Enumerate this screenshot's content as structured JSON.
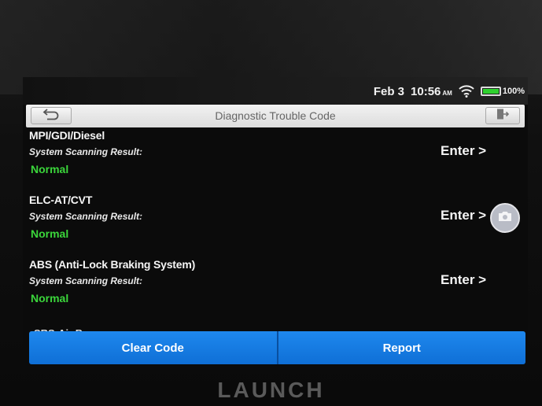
{
  "status_bar": {
    "date": "Feb 3",
    "time": "10:56",
    "ampm": "AM",
    "battery": "100%",
    "battery_level": 1.0,
    "icons": [
      "wifi-icon",
      "battery-icon"
    ]
  },
  "header": {
    "title": "Diagnostic Trouble Code",
    "back_icon": "back-arrow-icon",
    "exit_icon": "exit-icon"
  },
  "systems": [
    {
      "name": "MPI/GDI/Diesel",
      "label": "System Scanning Result:",
      "status": "Normal",
      "action": "Enter >"
    },
    {
      "name": "ELC-AT/CVT",
      "label": "System Scanning Result:",
      "status": "Normal",
      "action": "Enter >"
    },
    {
      "name": "ABS (Anti-Lock Braking System)",
      "label": "System Scanning Result:",
      "status": "Normal",
      "action": "Enter >"
    }
  ],
  "cutoff_item": "SRS-Air Bag",
  "floating_button_icon": "camera-icon",
  "actions": {
    "clear_code": "Clear Code",
    "report": "Report"
  },
  "brand": "LAUNCH",
  "colors": {
    "status_normal": "#3bd63b",
    "button_blue": "#1a7fe6",
    "battery_green": "#2fd12f"
  }
}
